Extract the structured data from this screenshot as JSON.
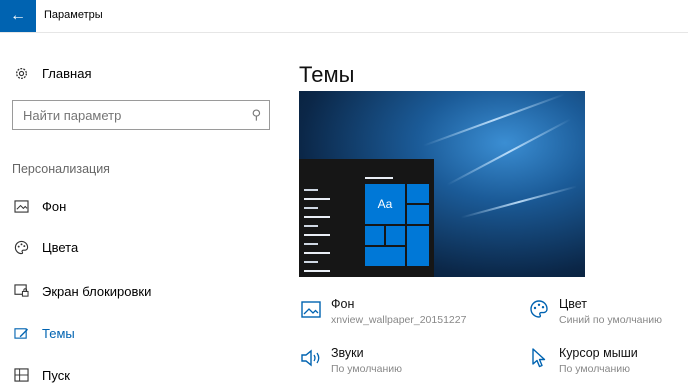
{
  "window": {
    "title": "Параметры"
  },
  "sidebar": {
    "home_label": "Главная",
    "search": {
      "placeholder": "Найти параметр"
    },
    "section_label": "Персонализация",
    "items": [
      {
        "label": "Фон",
        "icon": "image-icon"
      },
      {
        "label": "Цвета",
        "icon": "palette-icon"
      },
      {
        "label": "Экран блокировки",
        "icon": "lock-screen-icon"
      },
      {
        "label": "Темы",
        "icon": "themes-icon",
        "active": true
      },
      {
        "label": "Пуск",
        "icon": "start-icon"
      }
    ]
  },
  "main": {
    "title": "Темы",
    "preview": {
      "tile_label": "Aa"
    },
    "options": [
      {
        "title": "Фон",
        "subtitle": "xnview_wallpaper_20151227",
        "icon": "picture-icon"
      },
      {
        "title": "Цвет",
        "subtitle": "Синий по умолчанию",
        "icon": "palette-icon"
      },
      {
        "title": "Звуки",
        "subtitle": "По умолчанию",
        "icon": "speaker-icon"
      },
      {
        "title": "Курсор мыши",
        "subtitle": "По умолчанию",
        "icon": "cursor-icon"
      }
    ]
  },
  "colors": {
    "accent": "#0063b1",
    "tile": "#0078d7"
  }
}
